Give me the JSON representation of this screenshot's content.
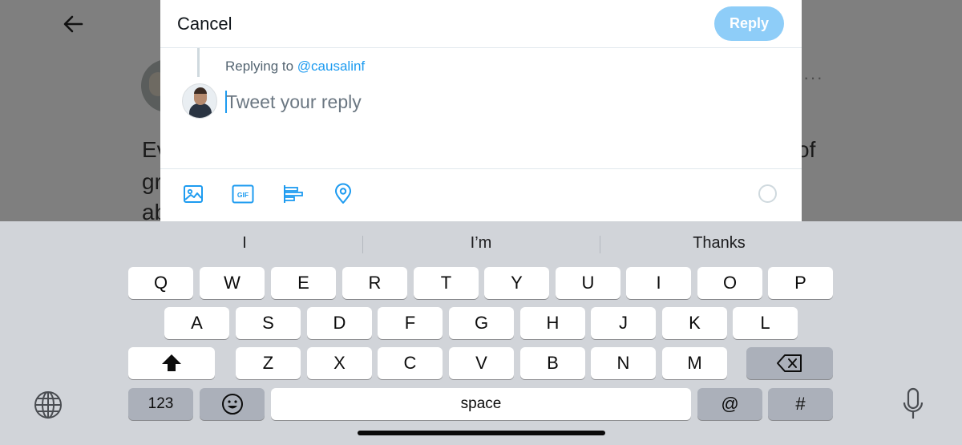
{
  "background_tweet": {
    "fragment_1": "Ev",
    "fragment_2": "gr",
    "fragment_3": "ab",
    "fragment_4": "of",
    "more_label": "···"
  },
  "modal": {
    "cancel_label": "Cancel",
    "reply_label": "Reply",
    "replying_prefix": "Replying to",
    "replying_handle": "@causalinf",
    "input_placeholder": "Tweet your reply",
    "input_value": "",
    "gif_label": "GIF"
  },
  "keyboard": {
    "predictions": [
      "I",
      "I’m",
      "Thanks"
    ],
    "row1": [
      "Q",
      "W",
      "E",
      "R",
      "T",
      "Y",
      "U",
      "I",
      "O",
      "P"
    ],
    "row2": [
      "A",
      "S",
      "D",
      "F",
      "G",
      "H",
      "J",
      "K",
      "L"
    ],
    "row3": [
      "Z",
      "X",
      "C",
      "V",
      "B",
      "N",
      "M"
    ],
    "numbers_label": "123",
    "space_label": "space",
    "at_label": "@",
    "hash_label": "#"
  },
  "colors": {
    "accent": "#1d9bf0",
    "reply_button_disabled": "#8ecdf8",
    "keyboard_bg": "#d1d4d9",
    "dim_overlay": "#7f7f7f"
  },
  "icons": [
    "back-arrow-icon",
    "image-icon",
    "gif-icon",
    "poll-icon",
    "location-icon",
    "globe-icon",
    "emoji-icon",
    "shift-icon",
    "backspace-icon",
    "microphone-icon"
  ]
}
